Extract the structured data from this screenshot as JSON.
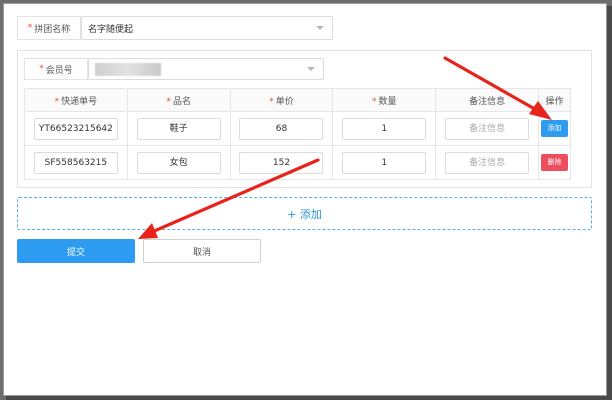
{
  "group_name": {
    "label": "拼团名称",
    "value": "名字随便起"
  },
  "member": {
    "label": "会员号",
    "value": "1871234xxxx"
  },
  "table": {
    "columns": [
      {
        "label": "快递单号",
        "required": true
      },
      {
        "label": "品名",
        "required": true
      },
      {
        "label": "单价",
        "required": true
      },
      {
        "label": "数量",
        "required": true
      },
      {
        "label": "备注信息",
        "required": false
      },
      {
        "label": "操作",
        "required": false
      }
    ],
    "rows": [
      {
        "tracking": "YT66523215642",
        "name": "鞋子",
        "price": "68",
        "qty": "1",
        "note_placeholder": "备注信息",
        "action": "添加"
      },
      {
        "tracking": "SF558563215",
        "name": "女包",
        "price": "152",
        "qty": "1",
        "note_placeholder": "备注信息",
        "action": "删除"
      }
    ]
  },
  "add_bar_label": "+ 添加",
  "submit_label": "提交",
  "cancel_label": "取消",
  "colors": {
    "primary": "#2d9cf0",
    "danger": "#ed4e5d",
    "required": "#e74c3c",
    "annotation_arrow": "#e8231b"
  },
  "annotations": [
    "red-arrow-to-add-button",
    "red-arrow-to-submit-button"
  ]
}
